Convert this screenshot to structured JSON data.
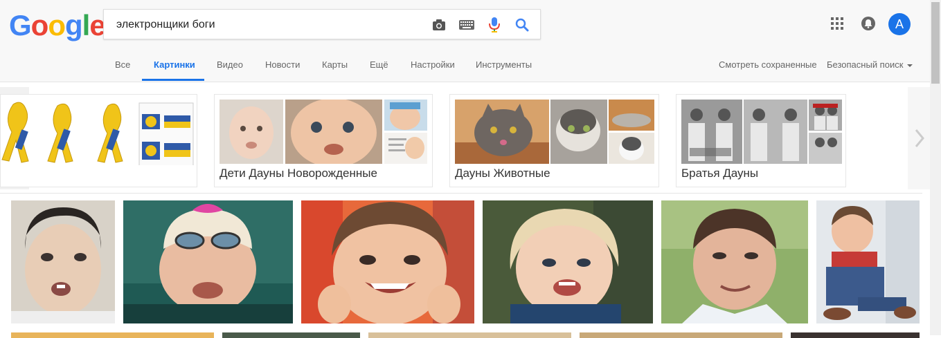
{
  "search": {
    "query": "электронщики боги"
  },
  "logo": {
    "letters": [
      "G",
      "o",
      "o",
      "g",
      "l",
      "e"
    ],
    "colors": [
      "#4285F4",
      "#EA4335",
      "#FBBC05",
      "#4285F4",
      "#34A853",
      "#EA4335"
    ]
  },
  "icons": {
    "camera": "camera-icon",
    "keyboard": "keyboard-icon",
    "mic": "microphone-icon",
    "search": "search-icon",
    "apps": "apps-grid-icon",
    "notifications": "notifications-icon"
  },
  "user": {
    "initial": "A"
  },
  "tabs": [
    {
      "label": "Все"
    },
    {
      "label": "Картинки",
      "active": true
    },
    {
      "label": "Видео"
    },
    {
      "label": "Новости"
    },
    {
      "label": "Карты"
    },
    {
      "label": "Ещё"
    },
    {
      "label": "Настройки"
    },
    {
      "label": "Инструменты"
    }
  ],
  "right_links": {
    "saved": "Смотреть сохраненные",
    "safe_search": "Безопасный поиск"
  },
  "related": [
    {
      "label": ""
    },
    {
      "label": "Дети Дауны Новорожденные"
    },
    {
      "label": "Дауны Животные"
    },
    {
      "label": "Братья Дауны"
    }
  ],
  "colors": {
    "accent": "#1a73e8"
  }
}
